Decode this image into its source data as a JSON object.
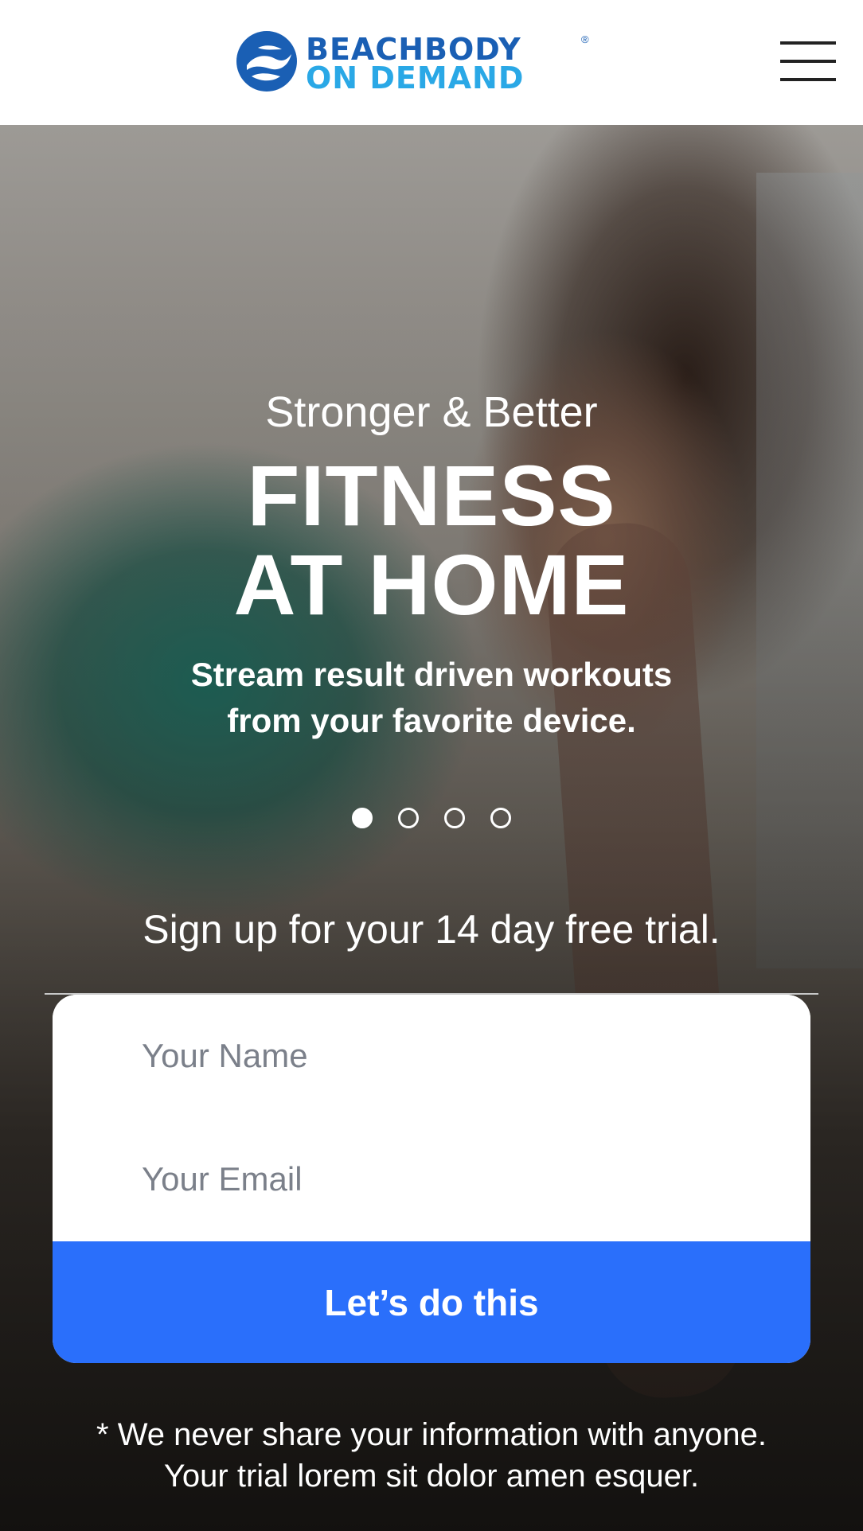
{
  "header": {
    "logo_line1": "BEACHBODY",
    "logo_line2": "ON DEMAND",
    "logo_reg": "®",
    "menu_icon": "hamburger-menu-icon"
  },
  "hero": {
    "eyebrow": "Stronger & Better",
    "headline_line1": "FITNESS",
    "headline_line2": "AT HOME",
    "subhead_line1": "Stream result driven workouts",
    "subhead_line2": "from your favorite device.",
    "carousel": {
      "count": 4,
      "active_index": 0
    }
  },
  "signup": {
    "cta_text": "Sign up for your 14 day free trial.",
    "name_placeholder": "Your Name",
    "email_placeholder": "Your Email",
    "submit_label": "Let’s do this",
    "disclaimer_line1": "* We never share your information with anyone.",
    "disclaimer_line2": "Your trial lorem sit dolor amen esquer."
  },
  "colors": {
    "brand_dark_blue": "#1a5fb4",
    "brand_light_blue": "#2aa8e6",
    "button_blue": "#2a6ffb"
  }
}
